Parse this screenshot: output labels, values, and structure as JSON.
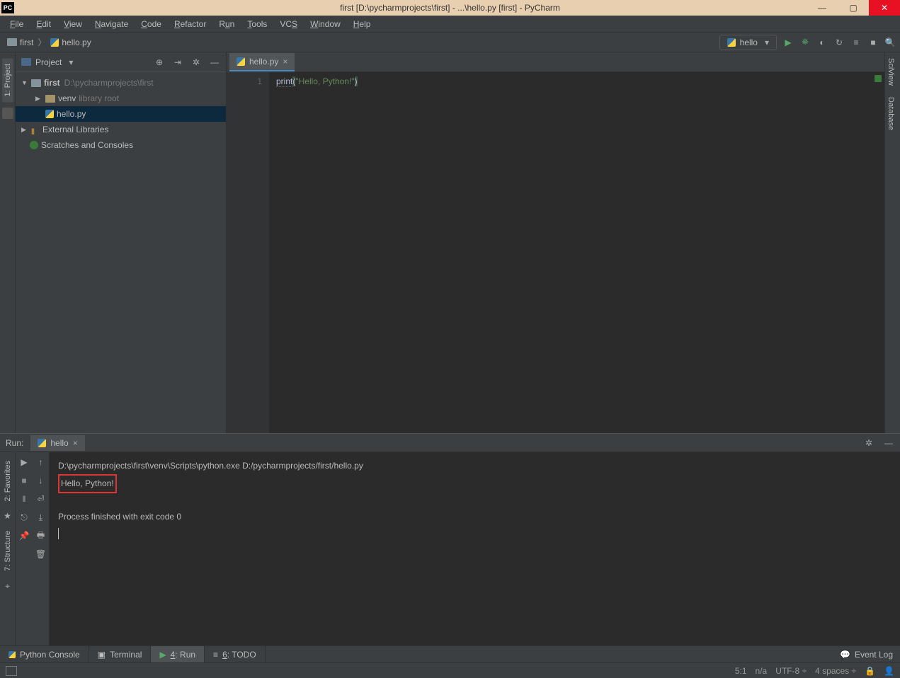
{
  "titlebar": {
    "icon_text": "PC",
    "title": "first [D:\\pycharmprojects\\first] - ...\\hello.py [first] - PyCharm"
  },
  "menubar": [
    "File",
    "Edit",
    "View",
    "Navigate",
    "Code",
    "Refactor",
    "Run",
    "Tools",
    "VCS",
    "Window",
    "Help"
  ],
  "breadcrumbs": {
    "folder": "first",
    "file": "hello.py"
  },
  "run_config": {
    "label": "hello"
  },
  "project_panel": {
    "title": "Project",
    "root": {
      "name": "first",
      "path": "D:\\pycharmprojects\\first"
    },
    "venv": {
      "name": "venv",
      "note": "library root"
    },
    "file": "hello.py",
    "ext_libs": "External Libraries",
    "scratches": "Scratches and Consoles"
  },
  "left_gutter": {
    "project_tab": "1: Project"
  },
  "right_gutter": {
    "sciview": "SciView",
    "database": "Database"
  },
  "editor": {
    "tab_name": "hello.py",
    "line_number": "1",
    "code": {
      "fn": "print",
      "lp": "(",
      "str": "\"Hello, Python!\"",
      "rp": ")"
    }
  },
  "run_panel": {
    "title": "Run:",
    "tab": "hello",
    "output_cmd": "D:\\pycharmprojects\\first\\venv\\Scripts\\python.exe D:/pycharmprojects/first/hello.py",
    "output_result": "Hello, Python!",
    "output_exit": "Process finished with exit code 0"
  },
  "fav_gutter": {
    "fav": "2: Favorites",
    "struct": "7: Structure"
  },
  "bottom_tabs": {
    "python_console": "Python Console",
    "terminal": "Terminal",
    "run": "4: Run",
    "todo": "6: TODO",
    "event_log": "Event Log"
  },
  "statusbar": {
    "pos": "5:1",
    "na": "n/a",
    "encoding": "UTF-8",
    "indent": "4 spaces"
  }
}
